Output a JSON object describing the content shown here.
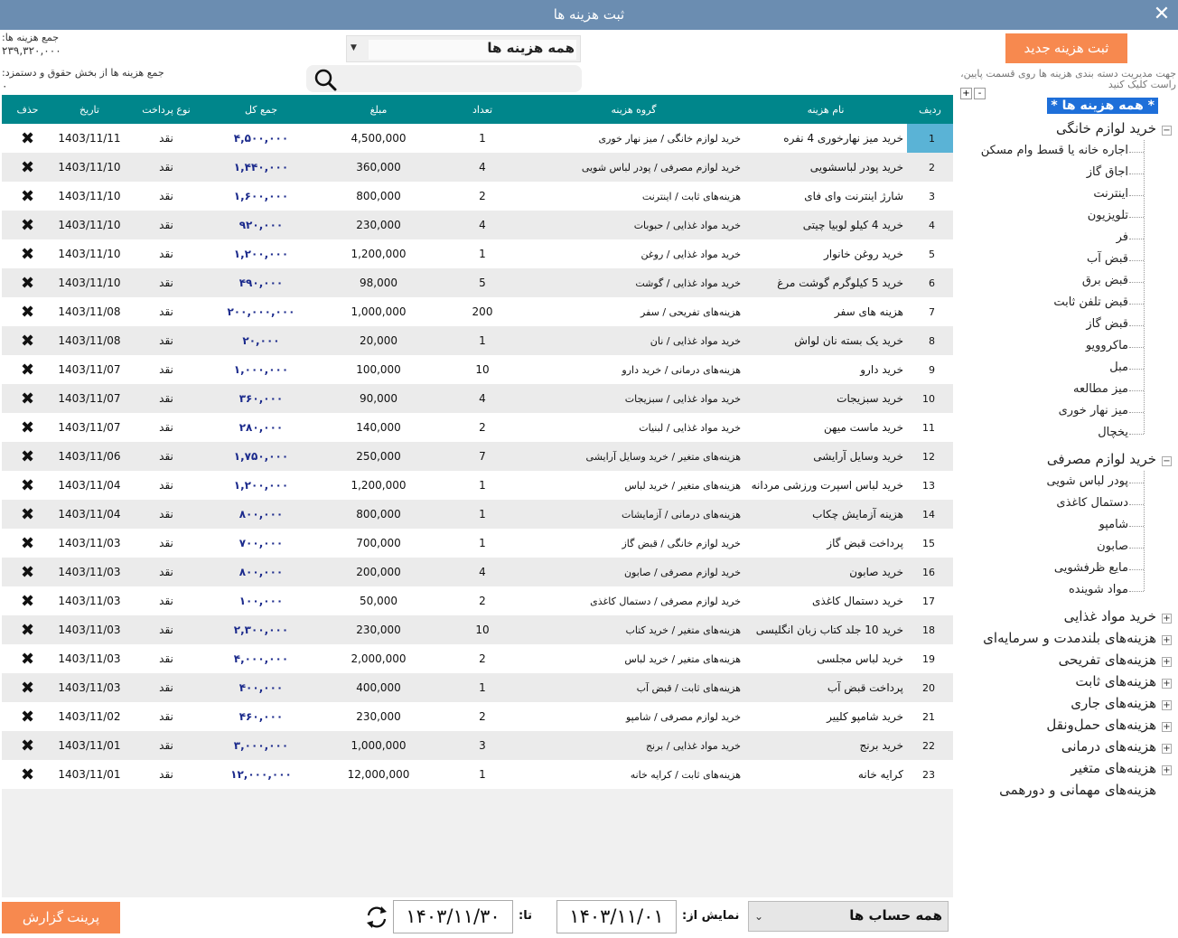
{
  "window": {
    "title": "ثبت هزینه ها",
    "close_glyph": "✕"
  },
  "totals": {
    "total_label": "جمع هزینه ها:",
    "total_value": "۲۳۹,۳۲۰,۰۰۰",
    "payroll_label": "جمع هزینه ها از بخش حقوق و دستمزد:",
    "payroll_value": "۰"
  },
  "filter": {
    "selected": "همه هزینه ها"
  },
  "search": {
    "value": "",
    "icon": "search-icon"
  },
  "right_panel": {
    "new_button": "ثبت هزینه جدید",
    "hint": "جهت مدیریت دسته بندی هزینه ها روی قسمت پایین، راست کلیک کنید",
    "zoom_in": "+",
    "zoom_out": "-"
  },
  "tree": {
    "root": "* همه هزینه ها *",
    "expanded": [
      {
        "label": "خرید لوازم خانگی",
        "toggle": "−",
        "items": [
          "اجاره خانه یا قسط وام مسکن",
          "اجاق گاز",
          "اینترنت",
          "تلویزیون",
          "فر",
          "قبض آب",
          "قبض برق",
          "قبض تلفن ثابت",
          "قبض گاز",
          "ماکروویو",
          "مبل",
          "میز مطالعه",
          "میز نهار خوری",
          "یخچال"
        ]
      },
      {
        "label": "خرید لوازم مصرفی",
        "toggle": "−",
        "items": [
          "پودر لباس شویی",
          "دستمال کاغذی",
          "شامپو",
          "صابون",
          "مایع ظرفشویی",
          "مواد شوینده"
        ]
      }
    ],
    "collapsed": [
      {
        "label": "خرید مواد غذایی",
        "toggle": "+"
      },
      {
        "label": "هزینه‌های بلندمدت و سرمایه‌ای",
        "toggle": "+"
      },
      {
        "label": "هزینه‌های تفریحی",
        "toggle": "+"
      },
      {
        "label": "هزینه‌های ثابت",
        "toggle": "+"
      },
      {
        "label": "هزینه‌های جاری",
        "toggle": "+"
      },
      {
        "label": "هزینه‌های حمل‌ونقل",
        "toggle": "+"
      },
      {
        "label": "هزینه‌های درمانی",
        "toggle": "+"
      },
      {
        "label": "هزینه‌های متغیر",
        "toggle": "+"
      },
      {
        "label": "هزینه‌های مهمانی و دورهمی",
        "toggle": ""
      }
    ]
  },
  "table": {
    "columns": [
      "ردیف",
      "نام هزینه",
      "گروه هزینه",
      "تعداد",
      "مبلغ",
      "جمع کل",
      "نوع پرداخت",
      "تاریخ",
      "حذف"
    ],
    "delete_glyph": "✖",
    "rows": [
      [
        "1",
        "خرید میز نهارخوری 4 نفره",
        "خرید لوازم خانگی / میز نهار خوری",
        "1",
        "4,500,000",
        "۴,۵۰۰,۰۰۰",
        "نقد",
        "1403/11/11"
      ],
      [
        "2",
        "خرید پودر لباسشویی",
        "خرید لوازم مصرفی / پودر لباس شویی",
        "4",
        "360,000",
        "۱,۴۴۰,۰۰۰",
        "نقد",
        "1403/11/10"
      ],
      [
        "3",
        "شارژ اینترنت وای فای",
        "هزینه‌های ثابت / اینترنت",
        "2",
        "800,000",
        "۱,۶۰۰,۰۰۰",
        "نقد",
        "1403/11/10"
      ],
      [
        "4",
        "خرید 4 کیلو لوبیا چیتی",
        "خرید مواد غذایی / حبوبات",
        "4",
        "230,000",
        "۹۲۰,۰۰۰",
        "نقد",
        "1403/11/10"
      ],
      [
        "5",
        "خرید روغن خانوار",
        "خرید مواد غذایی / روغن",
        "1",
        "1,200,000",
        "۱,۲۰۰,۰۰۰",
        "نقد",
        "1403/11/10"
      ],
      [
        "6",
        "خرید 5 کیلوگرم گوشت مرغ",
        "خرید مواد غذایی / گوشت",
        "5",
        "98,000",
        "۴۹۰,۰۰۰",
        "نقد",
        "1403/11/10"
      ],
      [
        "7",
        "هزینه های سفر",
        "هزینه‌های تفریحی / سفر",
        "200",
        "1,000,000",
        "۲۰۰,۰۰۰,۰۰۰",
        "نقد",
        "1403/11/08"
      ],
      [
        "8",
        "خرید یک بسته نان لواش",
        "خرید مواد غذایی / نان",
        "1",
        "20,000",
        "۲۰,۰۰۰",
        "نقد",
        "1403/11/08"
      ],
      [
        "9",
        "خرید دارو",
        "هزینه‌های درمانی / خرید دارو",
        "10",
        "100,000",
        "۱,۰۰۰,۰۰۰",
        "نقد",
        "1403/11/07"
      ],
      [
        "10",
        "خرید سبزیجات",
        "خرید مواد غذایی / سبزیجات",
        "4",
        "90,000",
        "۳۶۰,۰۰۰",
        "نقد",
        "1403/11/07"
      ],
      [
        "11",
        "خرید ماست میهن",
        "خرید مواد غذایی / لبنیات",
        "2",
        "140,000",
        "۲۸۰,۰۰۰",
        "نقد",
        "1403/11/07"
      ],
      [
        "12",
        "خرید وسایل آرایشی",
        "هزینه‌های متغیر / خرید وسایل آرایشی",
        "7",
        "250,000",
        "۱,۷۵۰,۰۰۰",
        "نقد",
        "1403/11/06"
      ],
      [
        "13",
        "خرید لباس اسپرت ورزشی مردانه",
        "هزینه‌های متغیر / خرید لباس",
        "1",
        "1,200,000",
        "۱,۲۰۰,۰۰۰",
        "نقد",
        "1403/11/04"
      ],
      [
        "14",
        "هزینه آزمایش چکاب",
        "هزینه‌های درمانی / آزمایشات",
        "1",
        "800,000",
        "۸۰۰,۰۰۰",
        "نقد",
        "1403/11/04"
      ],
      [
        "15",
        "پرداخت قبض گاز",
        "خرید لوازم خانگی / قبض گاز",
        "1",
        "700,000",
        "۷۰۰,۰۰۰",
        "نقد",
        "1403/11/03"
      ],
      [
        "16",
        "خرید صابون",
        "خرید لوازم مصرفی / صابون",
        "4",
        "200,000",
        "۸۰۰,۰۰۰",
        "نقد",
        "1403/11/03"
      ],
      [
        "17",
        "خرید دستمال کاغذی",
        "خرید لوازم مصرفی / دستمال کاغذی",
        "2",
        "50,000",
        "۱۰۰,۰۰۰",
        "نقد",
        "1403/11/03"
      ],
      [
        "18",
        "خرید 10 جلد کتاب زبان انگلیسی",
        "هزینه‌های متغیر / خرید کتاب",
        "10",
        "230,000",
        "۲,۳۰۰,۰۰۰",
        "نقد",
        "1403/11/03"
      ],
      [
        "19",
        "خرید لباس مجلسی",
        "هزینه‌های متغیر / خرید لباس",
        "2",
        "2,000,000",
        "۴,۰۰۰,۰۰۰",
        "نقد",
        "1403/11/03"
      ],
      [
        "20",
        "پرداخت قبض آب",
        "هزینه‌های ثابت / قبض آب",
        "1",
        "400,000",
        "۴۰۰,۰۰۰",
        "نقد",
        "1403/11/03"
      ],
      [
        "21",
        "خرید شامپو کلییر",
        "خرید لوازم مصرفی / شامپو",
        "2",
        "230,000",
        "۴۶۰,۰۰۰",
        "نقد",
        "1403/11/02"
      ],
      [
        "22",
        "خرید برنج",
        "خرید مواد غذایی / برنج",
        "3",
        "1,000,000",
        "۳,۰۰۰,۰۰۰",
        "نقد",
        "1403/11/01"
      ],
      [
        "23",
        "کرایه خانه",
        "هزینه‌های ثابت / کرایه خانه",
        "1",
        "12,000,000",
        "۱۲,۰۰۰,۰۰۰",
        "نقد",
        "1403/11/01"
      ]
    ]
  },
  "bottom": {
    "print_button": "پرینت گزارش",
    "from_label": "نمایش از:",
    "from_value": "۱۴۰۳/۱۱/۰۱",
    "to_label": "تا:",
    "to_value": "۱۴۰۳/۱۱/۳۰",
    "accounts": "همه حساب ها",
    "refresh_icon": "refresh-icon"
  }
}
